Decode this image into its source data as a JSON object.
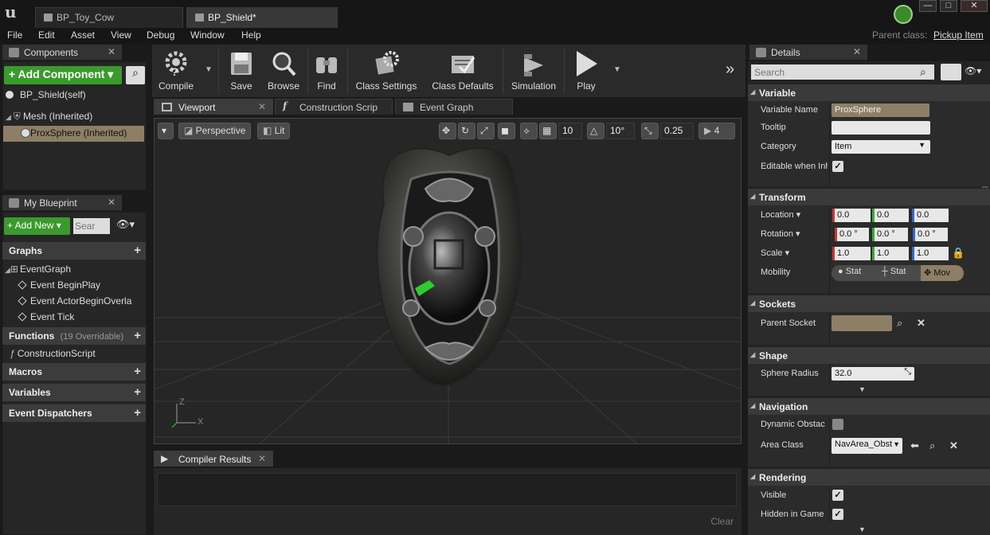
{
  "window": {
    "tabs": [
      {
        "label": "BP_Toy_Cow",
        "active": false
      },
      {
        "label": "BP_Shield*",
        "active": true
      }
    ],
    "controls": {
      "minimize": "—",
      "maximize": "□",
      "close": "✕"
    }
  },
  "menubar": {
    "items": [
      "File",
      "Edit",
      "Asset",
      "View",
      "Debug",
      "Window",
      "Help"
    ],
    "parent_class_label": "Parent class:",
    "parent_class_value": "Pickup Item"
  },
  "components_panel": {
    "title": "Components",
    "add_button": "+ Add Component ▾",
    "items": [
      {
        "label": "BP_Shield(self)"
      },
      {
        "label": "Mesh (Inherited)"
      },
      {
        "label": "ProxSphere (Inherited)",
        "selected": true
      }
    ]
  },
  "my_blueprint_panel": {
    "title": "My Blueprint",
    "add_new": "+ Add New ▾",
    "search_placeholder": "Sear",
    "sections": {
      "graphs": "Graphs",
      "event_graph": "EventGraph",
      "events": [
        "Event BeginPlay",
        "Event ActorBeginOverla",
        "Event Tick"
      ],
      "functions": "Functions",
      "functions_count": "(19 Overridable)",
      "construction_script": "ConstructionScript",
      "macros": "Macros",
      "variables": "Variables",
      "event_dispatchers": "Event Dispatchers"
    }
  },
  "toolbar": {
    "compile": "Compile",
    "save": "Save",
    "browse": "Browse",
    "find": "Find",
    "class_settings": "Class Settings",
    "class_defaults": "Class Defaults",
    "simulation": "Simulation",
    "play": "Play",
    "overflow": "»"
  },
  "editor_tabs": [
    {
      "label": "Viewport",
      "active": true
    },
    {
      "label": "Construction Scrip",
      "active": false
    },
    {
      "label": "Event Graph",
      "active": false
    }
  ],
  "viewport": {
    "perspective": "Perspective",
    "lit": "Lit",
    "grid_snap": "10",
    "rotation_snap": "10°",
    "scale_snap": "0.25",
    "camera_speed": "4",
    "axis_z": "Z",
    "axis_x": "X"
  },
  "compiler": {
    "title": "Compiler Results",
    "clear": "Clear"
  },
  "details": {
    "title": "Details",
    "search_placeholder": "Search",
    "variable": {
      "header": "Variable",
      "variable_name_label": "Variable Name",
      "variable_name_value": "ProxSphere",
      "tooltip_label": "Tooltip",
      "tooltip_value": "",
      "category_label": "Category",
      "category_value": "Item",
      "editable_label": "Editable when Inh",
      "editable_checked": true
    },
    "transform": {
      "header": "Transform",
      "location_label": "Location ▾",
      "location": [
        "0.0",
        "0.0",
        "0.0"
      ],
      "rotation_label": "Rotation ▾",
      "rotation": [
        "0.0 °",
        "0.0 °",
        "0.0 °"
      ],
      "scale_label": "Scale ▾",
      "scale": [
        "1.0",
        "1.0",
        "1.0"
      ],
      "mobility_label": "Mobility",
      "mobility_options": [
        "Stat",
        "Stat",
        "Mov"
      ]
    },
    "sockets": {
      "header": "Sockets",
      "parent_socket_label": "Parent Socket",
      "parent_socket_value": ""
    },
    "shape": {
      "header": "Shape",
      "sphere_radius_label": "Sphere Radius",
      "sphere_radius_value": "32.0"
    },
    "navigation": {
      "header": "Navigation",
      "dynamic_obstacle_label": "Dynamic Obstac",
      "area_class_label": "Area Class",
      "area_class_value": "NavArea_Obst"
    },
    "rendering": {
      "header": "Rendering",
      "visible_label": "Visible",
      "visible_checked": true,
      "hidden_in_game_label": "Hidden in Game",
      "hidden_in_game_checked": true
    }
  }
}
